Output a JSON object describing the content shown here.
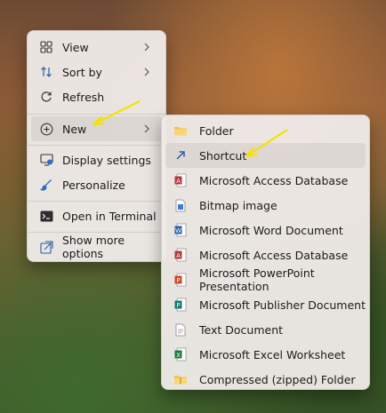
{
  "main_menu": {
    "items": [
      {
        "label": "View",
        "icon": "view-grid-icon",
        "has_submenu": true
      },
      {
        "label": "Sort by",
        "icon": "sort-icon",
        "has_submenu": true
      },
      {
        "label": "Refresh",
        "icon": "refresh-icon",
        "has_submenu": false
      },
      {
        "label": "New",
        "icon": "new-plus-icon",
        "has_submenu": true,
        "highlighted": true
      },
      {
        "label": "Display settings",
        "icon": "display-settings-icon",
        "has_submenu": false
      },
      {
        "label": "Personalize",
        "icon": "personalize-brush-icon",
        "has_submenu": false
      },
      {
        "label": "Open in Terminal",
        "icon": "terminal-icon",
        "has_submenu": false
      },
      {
        "label": "Show more options",
        "icon": "show-more-options-icon",
        "has_submenu": false
      }
    ]
  },
  "new_submenu": {
    "items": [
      {
        "label": "Folder",
        "icon": "folder-icon"
      },
      {
        "label": "Shortcut",
        "icon": "shortcut-icon",
        "highlighted": true
      },
      {
        "label": "Microsoft Access Database",
        "icon": "access-icon"
      },
      {
        "label": "Bitmap image",
        "icon": "bitmap-icon"
      },
      {
        "label": "Microsoft Word Document",
        "icon": "word-icon"
      },
      {
        "label": "Microsoft Access Database",
        "icon": "access-icon"
      },
      {
        "label": "Microsoft PowerPoint Presentation",
        "icon": "powerpoint-icon"
      },
      {
        "label": "Microsoft Publisher Document",
        "icon": "publisher-icon"
      },
      {
        "label": "Text Document",
        "icon": "text-document-icon"
      },
      {
        "label": "Microsoft Excel Worksheet",
        "icon": "excel-icon"
      },
      {
        "label": "Compressed (zipped) Folder",
        "icon": "zip-folder-icon"
      }
    ]
  },
  "colors": {
    "accent_arrow": "#f5e200",
    "highlight": "rgba(0,0,0,0.06)"
  }
}
